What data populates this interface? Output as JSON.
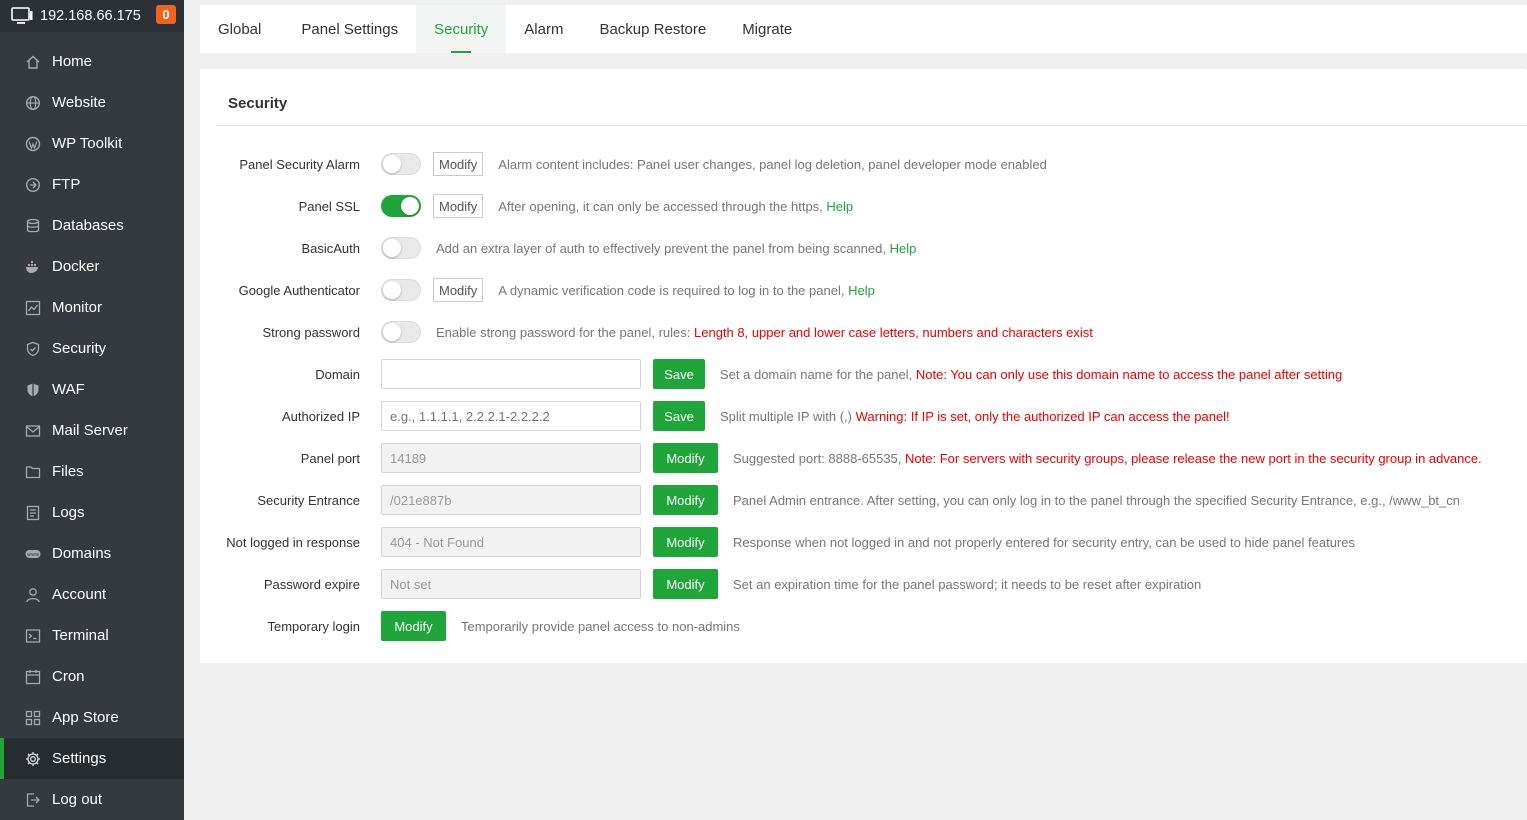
{
  "server": {
    "ip": "192.168.66.175",
    "badge": "0"
  },
  "sidebar": {
    "items": [
      {
        "label": "Home",
        "icon": "home-icon"
      },
      {
        "label": "Website",
        "icon": "globe-icon"
      },
      {
        "label": "WP Toolkit",
        "icon": "wordpress-icon"
      },
      {
        "label": "FTP",
        "icon": "ftp-icon"
      },
      {
        "label": "Databases",
        "icon": "database-icon"
      },
      {
        "label": "Docker",
        "icon": "docker-icon"
      },
      {
        "label": "Monitor",
        "icon": "monitor-icon"
      },
      {
        "label": "Security",
        "icon": "shield-icon"
      },
      {
        "label": "WAF",
        "icon": "waf-shield-icon"
      },
      {
        "label": "Mail Server",
        "icon": "mail-icon"
      },
      {
        "label": "Files",
        "icon": "folder-icon"
      },
      {
        "label": "Logs",
        "icon": "logs-icon"
      },
      {
        "label": "Domains",
        "icon": "www-icon"
      },
      {
        "label": "Account",
        "icon": "user-icon"
      },
      {
        "label": "Terminal",
        "icon": "terminal-icon"
      },
      {
        "label": "Cron",
        "icon": "calendar-icon"
      },
      {
        "label": "App Store",
        "icon": "apps-icon"
      },
      {
        "label": "Settings",
        "icon": "gear-icon"
      },
      {
        "label": "Log out",
        "icon": "logout-icon"
      }
    ],
    "active": "Settings"
  },
  "tabs": [
    "Global",
    "Panel Settings",
    "Security",
    "Alarm",
    "Backup Restore",
    "Migrate"
  ],
  "active_tab": "Security",
  "section_title": "Security",
  "modify_label": "Modify",
  "save_label": "Save",
  "rows": {
    "security_alarm": {
      "label": "Panel Security Alarm",
      "enabled": false,
      "desc": "Alarm content includes: Panel user changes, panel log deletion, panel developer mode enabled"
    },
    "ssl": {
      "label": "Panel SSL",
      "enabled": true,
      "desc": "After opening, it can only be accessed through the https,",
      "help": "Help"
    },
    "basic_auth": {
      "label": "BasicAuth",
      "enabled": false,
      "desc": "Add an extra layer of auth to effectively prevent the panel from being scanned,",
      "help": "Help"
    },
    "google_auth": {
      "label": "Google Authenticator",
      "enabled": false,
      "desc": "A dynamic verification code is required to log in to the panel,",
      "help": "Help"
    },
    "strong_password": {
      "label": "Strong password",
      "enabled": false,
      "desc": "Enable strong password for the panel, rules:",
      "warn": "Length 8, upper and lower case letters, numbers and characters exist"
    },
    "domain": {
      "label": "Domain",
      "value": "",
      "desc": "Set a domain name for the panel,",
      "warn": "Note: You can only use this domain name to access the panel after setting"
    },
    "authorized_ip": {
      "label": "Authorized IP",
      "placeholder": "e.g., 1.1.1.1, 2.2.2.1-2.2.2.2",
      "desc": "Split multiple IP with (,)",
      "warn": "Warning: If IP is set, only the authorized IP can access the panel!"
    },
    "panel_port": {
      "label": "Panel port",
      "value": "14189",
      "desc": "Suggested port: 8888-65535,",
      "warn": "Note: For servers with security groups, please release the new port in the security group in advance."
    },
    "security_entrance": {
      "label": "Security Entrance",
      "value": "/021e887b",
      "desc": "Panel Admin entrance. After setting, you can only log in to the panel through the specified Security Entrance, e.g., /www_bt_cn"
    },
    "not_logged": {
      "label": "Not logged in response",
      "value": "404 - Not Found",
      "desc": "Response when not logged in and not properly entered for security entry, can be used to hide panel features"
    },
    "password_expire": {
      "label": "Password expire",
      "value": "Not set",
      "desc": "Set an expiration time for the panel password; it needs to be reset after expiration"
    },
    "temp_login": {
      "label": "Temporary login",
      "desc": "Temporarily provide panel access to non-admins"
    }
  }
}
